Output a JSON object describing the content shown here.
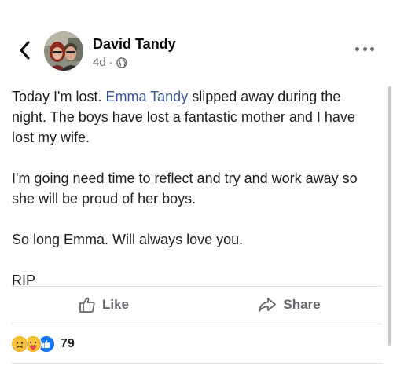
{
  "post": {
    "author": "David Tandy",
    "time": "4d",
    "separator": "·",
    "visibility_icon": "globe-icon",
    "body": {
      "p1_before": "Today I'm lost. ",
      "p1_mention": "Emma Tandy",
      "p1_after": " slipped away during the night. The boys have lost a fantastic mother and I have lost my wife.",
      "p2": "I'm going need time to reflect and try and work away so she will be proud of her boys.",
      "p3": "So long Emma. Will always love you.",
      "p4": "RIP"
    }
  },
  "actions": {
    "like_label": "Like",
    "share_label": "Share"
  },
  "reactions": {
    "icons": [
      "sad-icon",
      "care-icon",
      "like-icon"
    ],
    "count": "79"
  },
  "colors": {
    "mention": "#385898",
    "muted": "#65676b",
    "like_blue": "#1877f2",
    "reaction_yellow": "#f7b125",
    "divider": "#dcdfe3"
  }
}
